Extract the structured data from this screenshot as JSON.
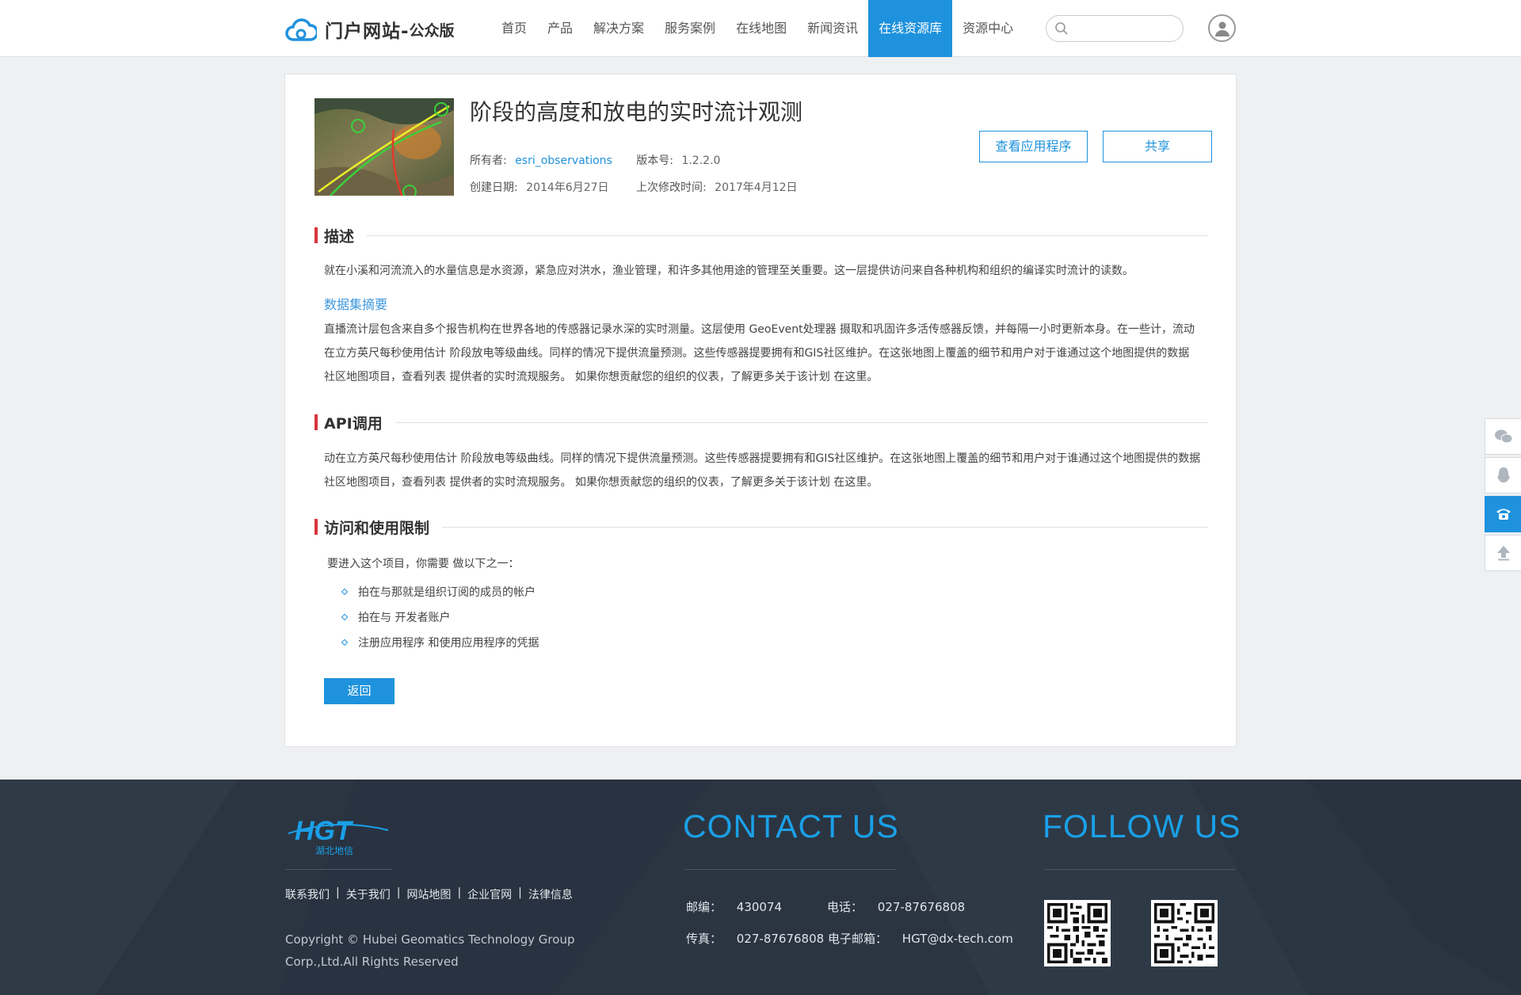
{
  "header": {
    "logo_text": "门户网站-",
    "logo_sub": "公众版",
    "nav": [
      {
        "label": "首页",
        "active": false
      },
      {
        "label": "产品",
        "active": false
      },
      {
        "label": "解决方案",
        "active": false
      },
      {
        "label": "服务案例",
        "active": false
      },
      {
        "label": "在线地图",
        "active": false
      },
      {
        "label": "新闻资讯",
        "active": false
      },
      {
        "label": "在线资源库",
        "active": true
      },
      {
        "label": "资源中心",
        "active": false
      }
    ],
    "search_placeholder": "",
    "icons": {
      "search": "search-icon",
      "user": "user-avatar-icon"
    }
  },
  "item": {
    "title": "阶段的高度和放电的实时流计观测",
    "owner_label": "所有者:",
    "owner": "esri_observations",
    "version_label": "版本号:",
    "version": "1.2.2.0",
    "created_label": "创建日期:",
    "created": "2014年6月27日",
    "modified_label": "上次修改时间:",
    "modified": "2017年4月12日",
    "view_app_button": "查看应用程序",
    "share_button": "共享"
  },
  "sections": {
    "description": {
      "title": "描述",
      "text": "就在小溪和河流流入的水量信息是水资源，紧急应对洪水，渔业管理，和许多其他用途的管理至关重要。这一层提供访问来自各种机构和组织的编译实时流计的读数。",
      "subhead": "数据集摘要",
      "summary": "直播流计层包含来自多个报告机构在世界各地的传感器记录水深的实时测量。这层使用   GeoEvent处理器   摄取和巩固许多活传感器反馈，并每隔一小时更新本身。在一些计，流动在立方英尺每秒使用估计   阶段放电等级曲线。同样的情况下提供流量预测。这些传感器提要拥有和GIS社区维护。在这张地图上覆盖的细节和用户对于谁通过这个地图提供的数据   社区地图项目，查看列表   提供者的实时流规服务。  如果你想贡献您的组织的仪表，了解更多关于该计划   在这里。"
    },
    "api": {
      "title": "API调用",
      "text": "动在立方英尺每秒使用估计   阶段放电等级曲线。同样的情况下提供流量预测。这些传感器提要拥有和GIS社区维护。在这张地图上覆盖的细节和用户对于谁通过这个地图提供的数据   社区地图项目，查看列表   提供者的实时流规服务。  如果你想贡献您的组织的仪表，了解更多关于该计划   在这里。"
    },
    "access": {
      "title": "访问和使用限制",
      "intro": "要进入这个项目，你需要 做以下之一：",
      "items": [
        "拍在与那就是组织订阅的成员的帐户",
        "拍在与 开发者账户",
        "注册应用程序 和使用应用程序的凭据"
      ]
    }
  },
  "back_button": "返回",
  "side_tools": [
    "wechat-icon",
    "qq-icon",
    "phone-icon",
    "back-to-top-icon"
  ],
  "footer": {
    "logo_text": "HGT",
    "logo_sub": "湖北地信",
    "links": [
      "联系我们",
      "关于我们",
      "网站地图",
      "企业官网",
      "法律信息"
    ],
    "copyright": "Copyright © Hubei Geomatics Technology Group Corp.,Ltd.All Rights Reserved",
    "contact_heading": "CONTACT US",
    "follow_heading": "FOLLOW US",
    "postcode_label": "邮编：",
    "postcode": "430074",
    "phone_label": "电话：",
    "phone": "027-87676808",
    "fax_label": "传真：",
    "fax": "027-87676808",
    "email_label": "电子邮箱：",
    "email": "HGT@dx-tech.com"
  },
  "colors": {
    "accent": "#1f92dd",
    "section_bar": "#d9343c",
    "footer_bg": "#2b3541",
    "footer_heading": "#1aa0e8"
  }
}
